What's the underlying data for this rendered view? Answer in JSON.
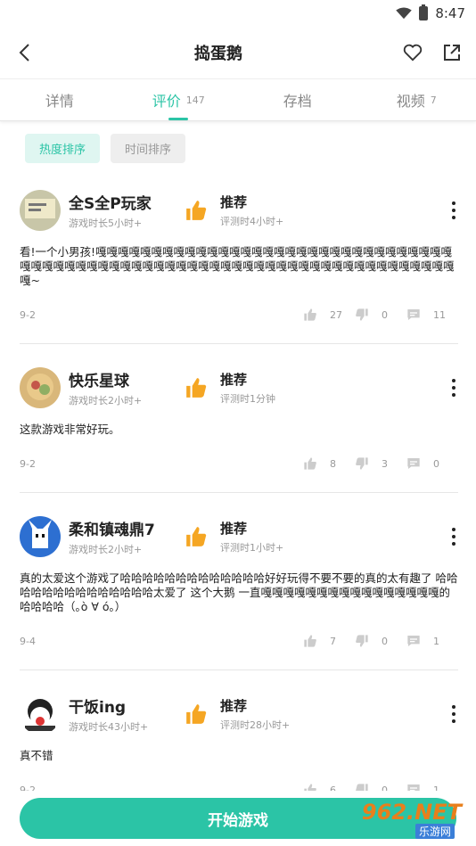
{
  "status": {
    "time": "8:47"
  },
  "header": {
    "title": "捣蛋鹅"
  },
  "tabs": [
    {
      "label": "详情",
      "count": ""
    },
    {
      "label": "评价",
      "count": "147"
    },
    {
      "label": "存档",
      "count": ""
    },
    {
      "label": "视频",
      "count": "7"
    }
  ],
  "sort": {
    "hot": "热度排序",
    "time": "时间排序"
  },
  "reviews": [
    {
      "name": "全S全P玩家",
      "playtime": "游戏时长5小时+",
      "verdict": "推荐",
      "review_time": "评测时4小时+",
      "content": "看!一个小男孩!嘎嘎嘎嘎嘎嘎嘎嘎嘎嘎嘎嘎嘎嘎嘎嘎嘎嘎嘎嘎嘎嘎嘎嘎嘎嘎嘎嘎嘎嘎嘎嘎嘎嘎嘎嘎嘎嘎嘎嘎嘎嘎嘎嘎嘎嘎嘎嘎嘎嘎嘎嘎嘎嘎嘎嘎嘎嘎嘎嘎嘎嘎嘎嘎嘎嘎嘎嘎嘎嘎嘎嘎~",
      "date": "9-2",
      "likes": "27",
      "dislikes": "0",
      "comments": "11"
    },
    {
      "name": "快乐星球",
      "playtime": "游戏时长2小时+",
      "verdict": "推荐",
      "review_time": "评测时1分钟",
      "content": "这款游戏非常好玩。",
      "date": "9-2",
      "likes": "8",
      "dislikes": "3",
      "comments": "0"
    },
    {
      "name": "柔和镇魂鼎7",
      "playtime": "游戏时长2小时+",
      "verdict": "推荐",
      "review_time": "评测时1小时+",
      "content": "真的太爱这个游戏了哈哈哈哈哈哈哈哈哈哈哈哈哈好好玩得不要不要的真的太有趣了 哈哈哈哈哈哈哈哈哈哈哈哈哈哈太爱了 这个大鹅 一直嘎嘎嘎嘎嘎嘎嘎嘎嘎嘎嘎嘎嘎嘎嘎嘎的哈哈哈哈（｡ò ∀ ó｡）",
      "date": "9-4",
      "likes": "7",
      "dislikes": "0",
      "comments": "1"
    },
    {
      "name": "干饭ing",
      "playtime": "游戏时长43小时+",
      "verdict": "推荐",
      "review_time": "评测时28小时+",
      "content": "真不错",
      "date": "9-2",
      "likes": "6",
      "dislikes": "0",
      "comments": "1"
    }
  ],
  "footer": {
    "start": "开始游戏"
  },
  "watermark": {
    "main": "962.NET",
    "sub": "乐游网"
  },
  "colors": {
    "accent": "#2bc4a6",
    "thumb": "#f5a623"
  }
}
